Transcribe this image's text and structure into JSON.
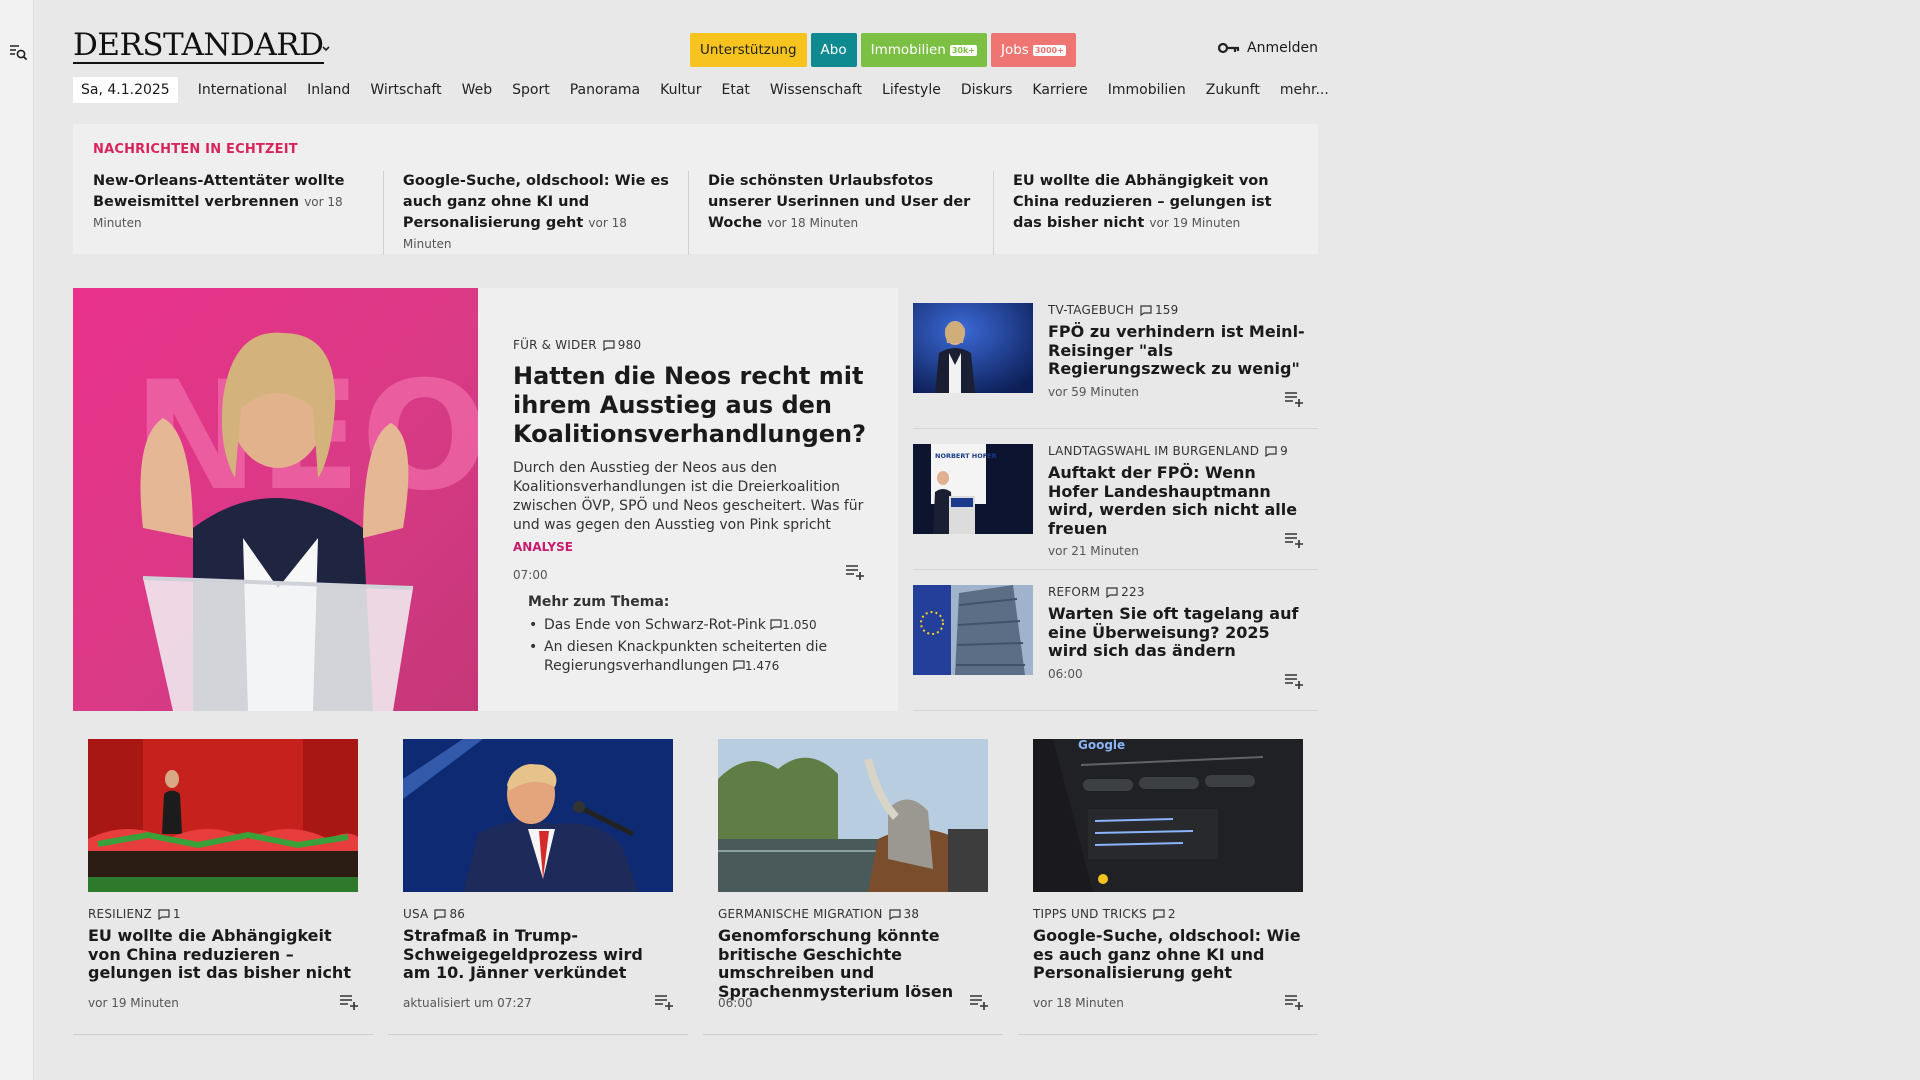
{
  "header": {
    "logo": "DERSTANDARD",
    "pills": [
      {
        "label": "Unterstützung",
        "badge": ""
      },
      {
        "label": "Abo",
        "badge": ""
      },
      {
        "label": "Immobilien",
        "badge": "30k+"
      },
      {
        "label": "Jobs",
        "badge": "3000+"
      }
    ],
    "login_label": "Anmelden"
  },
  "nav": {
    "date": "Sa, 4.1.2025",
    "items": [
      "International",
      "Inland",
      "Wirtschaft",
      "Web",
      "Sport",
      "Panorama",
      "Kultur",
      "Etat",
      "Wissenschaft",
      "Lifestyle",
      "Diskurs",
      "Karriere",
      "Immobilien",
      "Zukunft",
      "mehr..."
    ]
  },
  "ticker": {
    "heading": "NACHRICHTEN IN ECHTZEIT",
    "items": [
      {
        "title": "New-Orleans-Attentäter wollte Beweismittel verbrennen",
        "time": "vor 18 Minuten"
      },
      {
        "title": "Google-Suche, oldschool: Wie es auch ganz ohne KI und Personalisierung geht",
        "time": "vor 18 Minuten"
      },
      {
        "title": "Die schönsten Urlaubsfotos unserer Userinnen und User der Woche",
        "time": "vor 18 Minuten"
      },
      {
        "title": "EU wollte die Abhängigkeit von China reduzieren – gelungen ist das bisher nicht",
        "time": "vor 19 Minuten"
      }
    ]
  },
  "hero": {
    "kicker": "FÜR & WIDER",
    "comments": "980",
    "title": "Hatten die Neos recht mit ihrem Ausstieg aus den Koalitionsverhandlungen?",
    "lead": "Durch den Ausstieg der Neos aus den Koalitionsverhandlungen ist die Dreierkoalition zwischen ÖVP, SPÖ und Neos gescheitert. Was für und was gegen den Ausstieg von Pink spricht",
    "tag": "ANALYSE",
    "time": "07:00",
    "image_text": "NEOS",
    "more_heading": "Mehr zum Thema:",
    "more": [
      {
        "title": "Das Ende von Schwarz-Rot-Pink",
        "comments": "1.050"
      },
      {
        "title": "An diesen Knackpunkten scheiterten die Regierungsverhandlungen",
        "comments": "1.476"
      }
    ]
  },
  "side": [
    {
      "kicker": "TV-TAGEBUCH",
      "comments": "159",
      "title": "FPÖ zu verhindern ist Meinl-Reisinger \"als Regierungszweck zu wenig\"",
      "time": "vor 59 Minuten"
    },
    {
      "kicker": "LANDTAGSWAHL IM BURGENLAND",
      "comments": "9",
      "title": "Auftakt der FPÖ: Wenn Hofer Landeshauptmann wird, werden sich nicht alle freuen",
      "time": "vor 21 Minuten",
      "image_text": "NORBERT HOFER"
    },
    {
      "kicker": "REFORM",
      "comments": "223",
      "title": "Warten Sie oft tagelang auf eine Überweisung? 2025 wird sich das ändern",
      "time": "06:00"
    }
  ],
  "cards": [
    {
      "kicker": "RESILIENZ",
      "comments": "1",
      "title": "EU wollte die Abhängigkeit von China reduzieren – gelungen ist das bisher nicht",
      "time": "vor 19 Minuten"
    },
    {
      "kicker": "USA",
      "comments": "86",
      "title": "Strafmaß in Trump-Schweigegeldprozess wird am 10. Jänner verkündet",
      "time": "aktualisiert um 07:27"
    },
    {
      "kicker": "GERMANISCHE MIGRATION",
      "comments": "38",
      "title": "Genomforschung könnte britische Geschichte umschreiben und Sprachenmysterium lösen",
      "time": "06:00"
    },
    {
      "kicker": "TIPPS UND TRICKS",
      "comments": "2",
      "title": "Google-Suche, oldschool: Wie es auch ganz ohne KI und Personalisierung geht",
      "time": "vor 18 Minuten",
      "image_text": "Google"
    }
  ],
  "colors": {
    "accent_pink": "#d8235c",
    "analyse": "#c81b70",
    "support": "#f6c31f",
    "abo": "#0f8a90",
    "immo": "#7bc043",
    "jobs": "#ef7572"
  }
}
